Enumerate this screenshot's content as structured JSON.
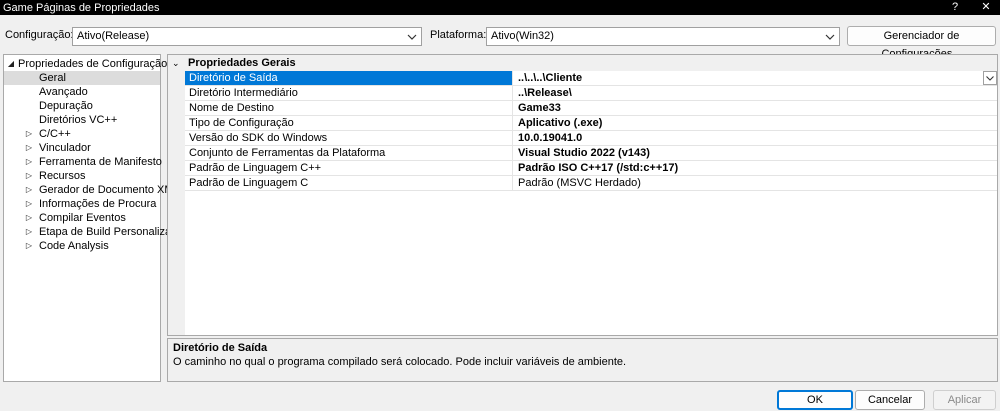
{
  "window": {
    "title": "Game Páginas de Propriedades",
    "help": "?",
    "close": "✕"
  },
  "toolbar": {
    "config_label": "Configuração:",
    "config_value": "Ativo(Release)",
    "platform_label": "Plataforma:",
    "platform_value": "Ativo(Win32)",
    "manager_button": "Gerenciador de Configurações..."
  },
  "tree": {
    "items": [
      {
        "label": "Propriedades de Configuração",
        "expander": "◢"
      },
      {
        "label": "Geral"
      },
      {
        "label": "Avançado"
      },
      {
        "label": "Depuração"
      },
      {
        "label": "Diretórios VC++"
      },
      {
        "label": "C/C++",
        "expander": "▷"
      },
      {
        "label": "Vinculador",
        "expander": "▷"
      },
      {
        "label": "Ferramenta de Manifesto",
        "expander": "▷"
      },
      {
        "label": "Recursos",
        "expander": "▷"
      },
      {
        "label": "Gerador de Documento XML",
        "expander": "▷"
      },
      {
        "label": "Informações de Procura",
        "expander": "▷"
      },
      {
        "label": "Compilar Eventos",
        "expander": "▷"
      },
      {
        "label": "Etapa de Build Personalizado",
        "expander": "▷"
      },
      {
        "label": "Code Analysis",
        "expander": "▷"
      }
    ]
  },
  "grid": {
    "section": "Propriedades Gerais",
    "section_expander": "⌄",
    "rows": [
      {
        "name": "Diretório de Saída",
        "value": "..\\..\\..\\Cliente"
      },
      {
        "name": "Diretório Intermediário",
        "value": "..\\Release\\"
      },
      {
        "name": "Nome de Destino",
        "value": "Game33"
      },
      {
        "name": "Tipo de Configuração",
        "value": "Aplicativo (.exe)"
      },
      {
        "name": "Versão do SDK do Windows",
        "value": "10.0.19041.0"
      },
      {
        "name": "Conjunto de Ferramentas da Plataforma",
        "value": "Visual Studio 2022 (v143)"
      },
      {
        "name": "Padrão de Linguagem C++",
        "value": "Padrão ISO C++17 (/std:c++17)"
      },
      {
        "name": "Padrão de Linguagem C",
        "value": "Padrão (MSVC Herdado)"
      }
    ]
  },
  "description": {
    "title": "Diretório de Saída",
    "text": "O caminho no qual o programa compilado será colocado. Pode incluir variáveis de ambiente."
  },
  "buttons": {
    "ok": "OK",
    "cancel": "Cancelar",
    "apply": "Aplicar"
  },
  "colors": {
    "selection": "#0078d7",
    "titlebar": "#000000"
  }
}
